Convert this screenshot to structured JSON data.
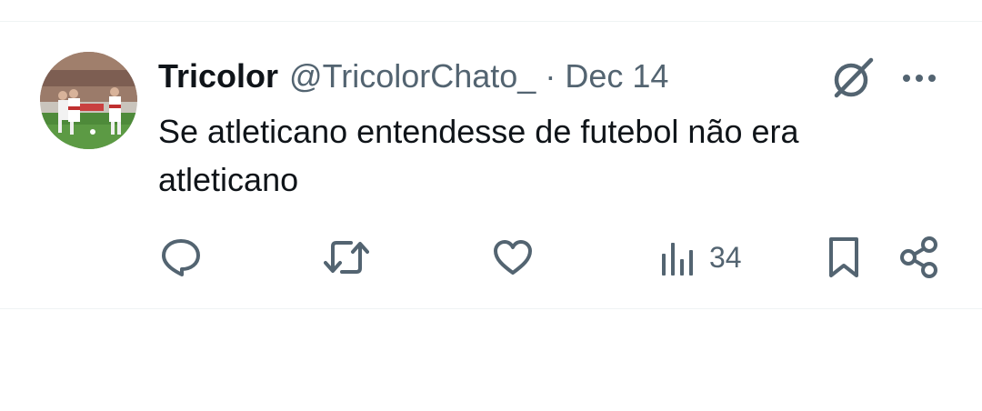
{
  "tweet": {
    "display_name": "Tricolor",
    "handle": "@TricolorChato_",
    "separator": "·",
    "date": "Dec 14",
    "text": "Se atleticano entendesse de futebol não era atleticano"
  },
  "actions": {
    "reply_icon": "speech-bubble-icon",
    "retweet_icon": "retweet-arrows-icon",
    "like_icon": "heart-icon",
    "views_icon": "bar-chart-icon",
    "views_count": "34",
    "bookmark_icon": "bookmark-icon",
    "share_icon": "share-icon"
  },
  "header_icons": {
    "grok": "grok-icon",
    "more": "more-dots-icon"
  },
  "colors": {
    "text": "#0f1419",
    "secondary": "#536471",
    "divider": "#eff3f4"
  }
}
